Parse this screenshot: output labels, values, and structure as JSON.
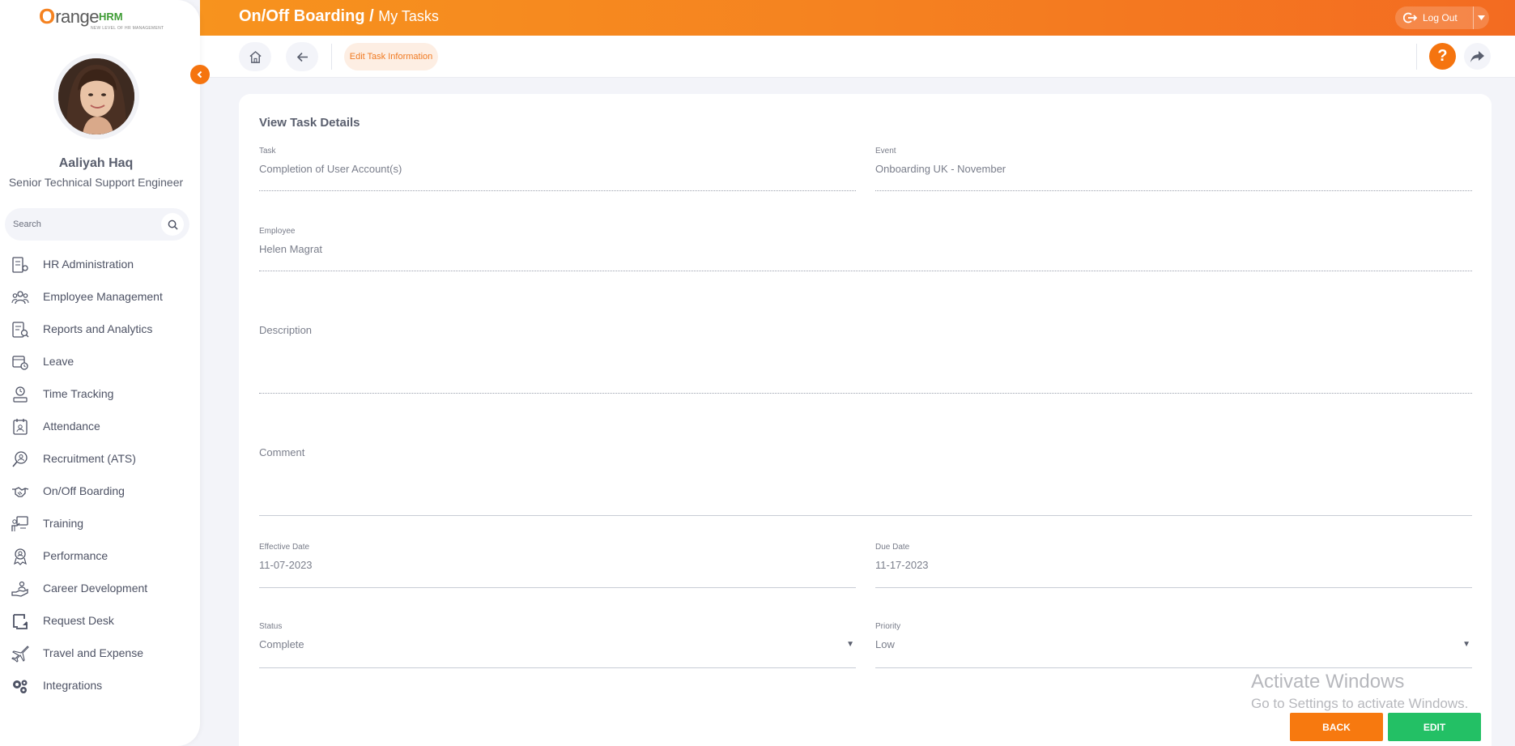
{
  "app": {
    "logo_mark": "O",
    "logo_text": "range",
    "logo_hrm": "HRM",
    "logo_tagline": "NEW LEVEL OF HR MANAGEMENT"
  },
  "user": {
    "name": "Aaliyah Haq",
    "title": "Senior Technical Support Engineer"
  },
  "search": {
    "placeholder": "Search"
  },
  "menu": [
    {
      "label": "HR Administration",
      "icon": "hr-admin-icon"
    },
    {
      "label": "Employee Management",
      "icon": "employees-icon"
    },
    {
      "label": "Reports and Analytics",
      "icon": "reports-icon"
    },
    {
      "label": "Leave",
      "icon": "leave-icon"
    },
    {
      "label": "Time Tracking",
      "icon": "time-tracking-icon"
    },
    {
      "label": "Attendance",
      "icon": "attendance-icon"
    },
    {
      "label": "Recruitment (ATS)",
      "icon": "recruitment-icon"
    },
    {
      "label": "On/Off Boarding",
      "icon": "handshake-icon"
    },
    {
      "label": "Training",
      "icon": "training-icon"
    },
    {
      "label": "Performance",
      "icon": "performance-icon"
    },
    {
      "label": "Career Development",
      "icon": "career-icon"
    },
    {
      "label": "Request Desk",
      "icon": "request-desk-icon"
    },
    {
      "label": "Travel and Expense",
      "icon": "airplane-icon"
    },
    {
      "label": "Integrations",
      "icon": "puzzle-icon"
    }
  ],
  "header": {
    "module": "On/Off Boarding",
    "separator": " / ",
    "page": "My Tasks",
    "logout_label": "Log Out"
  },
  "toolbar": {
    "edit_chip": "Edit Task Information",
    "help": "?"
  },
  "card": {
    "title": "View Task Details",
    "task_label": "Task",
    "task_value": "Completion of User Account(s)",
    "event_label": "Event",
    "event_value": "Onboarding UK - November",
    "employee_label": "Employee",
    "employee_value": "Helen Magrat",
    "description_label": "Description",
    "comment_label": "Comment",
    "effective_date_label": "Effective Date",
    "effective_date_value": "11-07-2023",
    "due_date_label": "Due Date",
    "due_date_value": "11-17-2023",
    "status_label": "Status",
    "status_value": "Complete",
    "priority_label": "Priority",
    "priority_value": "Low"
  },
  "buttons": {
    "back": "BACK",
    "edit": "EDIT"
  },
  "watermark": {
    "line1": "Activate Windows",
    "line2": "Go to Settings to activate Windows."
  },
  "colors": {
    "accent": "#f58220",
    "success": "#23c065"
  }
}
